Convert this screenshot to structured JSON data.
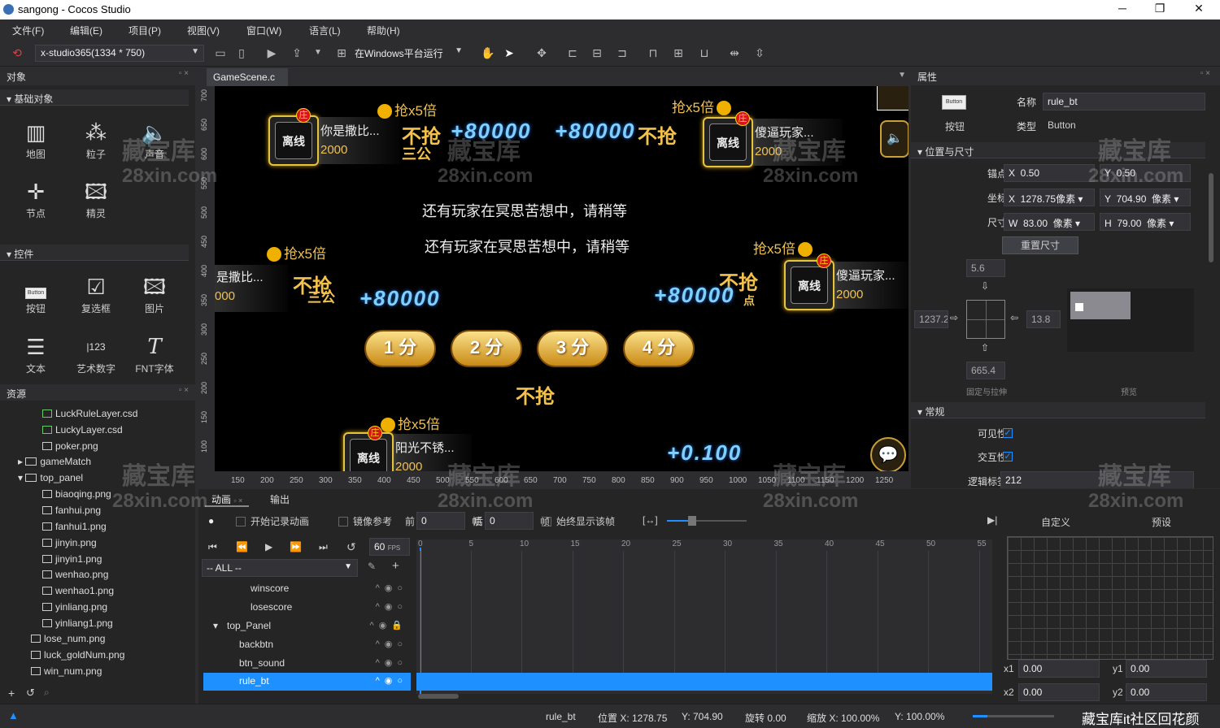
{
  "window": {
    "title": "sangong - Cocos Studio",
    "min": "─",
    "max": "❐",
    "close": "✕"
  },
  "menu": [
    "文件(F)",
    "编辑(E)",
    "项目(P)",
    "视图(V)",
    "窗口(W)",
    "语言(L)",
    "帮助(H)"
  ],
  "toolbar": {
    "resolution": "x-studio365(1334 * 750)",
    "run_target": "在Windows平台运行"
  },
  "objects_panel": {
    "title": "对象",
    "basic_section": "基础对象",
    "basic_items": [
      "地图",
      "粒子",
      "声音",
      "节点",
      "精灵"
    ],
    "controls_section": "控件",
    "control_items": [
      "按钮",
      "复选框",
      "图片",
      "文本",
      "艺术数字",
      "FNT字体"
    ]
  },
  "resources_panel": {
    "title": "资源",
    "items": [
      "LuckRuleLayer.csd",
      "LuckyLayer.csd",
      "poker.png",
      "gameMatch",
      "top_panel",
      "biaoqing.png",
      "fanhui.png",
      "fanhui1.png",
      "jinyin.png",
      "jinyin1.png",
      "wenhao.png",
      "wenhao1.png",
      "yinliang.png",
      "yinliang1.png",
      "lose_num.png",
      "luck_goldNum.png",
      "win_num.png"
    ]
  },
  "scene_tab": "GameScene.c",
  "scene": {
    "rob_label": "抢x5倍",
    "zhuang": "庄",
    "offline": "离线",
    "player1_name": "你是撒比...",
    "player1_score": "2000",
    "player2_name": "傻逼玩家...",
    "player2_score": "2000",
    "player3_name": "是撒比...",
    "player3_score": "000",
    "player4_name": "傻逼玩家...",
    "player4_score": "2000",
    "player5_name": "阳光不锈...",
    "player5_score": "2000",
    "gain1": "+80000",
    "gain2": "+80000",
    "gain3": "+80000",
    "gain4": "+80000",
    "waiting1": "还有玩家在冥思苦想中，请稍等",
    "waiting2": "还有玩家在冥思苦想中，请稍等",
    "no_rob": "不抢",
    "sangong": "三公",
    "score_buttons": [
      "1 分",
      "2 分",
      "3 分",
      "4 分"
    ],
    "bottom_num": "+0.100",
    "point_tag": "点"
  },
  "ruler_h": [
    "150",
    "200",
    "250",
    "300",
    "350",
    "400",
    "450",
    "500",
    "550",
    "600",
    "650",
    "700",
    "750",
    "800",
    "850",
    "900",
    "950",
    "1000",
    "1050",
    "1100",
    "1150",
    "1200",
    "1250"
  ],
  "ruler_v": [
    "700",
    "650",
    "600",
    "550",
    "500",
    "450",
    "400",
    "350",
    "300",
    "250",
    "200",
    "150",
    "100"
  ],
  "properties": {
    "title": "属性",
    "type_icon": "Button",
    "type_caption": "按钮",
    "name_label": "名称",
    "name_value": "rule_bt",
    "kind_label": "类型",
    "kind_value": "Button",
    "pos_section": "位置与尺寸",
    "anchor_label": "锚点",
    "anchor_x": "0.50",
    "anchor_y": "0.50",
    "pos_label": "坐标",
    "pos_x": "1278.75",
    "pos_y": "704.90",
    "unit": "像素",
    "size_label": "尺寸",
    "size_w": "83.00",
    "size_h": "79.00",
    "reset_size": "重置尺寸",
    "margin_top": "5.6",
    "margin_left": "1237.2",
    "margin_right": "13.8",
    "margin_bottom": "665.4",
    "fix_label": "固定与拉伸",
    "preview_label": "预览",
    "general_section": "常规",
    "visible_label": "可见性",
    "interactive_label": "交互性",
    "logic_tag_label": "逻辑标签",
    "logic_tag_value": "212"
  },
  "animation": {
    "tab_anim": "动画",
    "tab_output": "输出",
    "record": "开始记录动画",
    "mirror": "镜像参考",
    "before_label": "前",
    "before_val": "0",
    "after_label": "后",
    "after_val": "0",
    "frame_unit": "帧",
    "show_frame": "始终显示该帧",
    "fps": "60",
    "fps_unit": "FPS",
    "filter": "-- ALL --",
    "custom": "自定义",
    "preset": "预设",
    "timeline_ticks": [
      "0",
      "5",
      "10",
      "15",
      "20",
      "25",
      "30",
      "35",
      "40",
      "45",
      "50",
      "55"
    ],
    "nodes": [
      "winscore",
      "losescore",
      "top_Panel",
      "backbtn",
      "btn_sound",
      "rule_bt"
    ],
    "x1": "x1",
    "x1_val": "0.00",
    "y1": "y1",
    "y1_val": "0.00",
    "x2": "x2",
    "x2_val": "0.00",
    "y2": "y2",
    "y2_val": "0.00"
  },
  "status": {
    "node": "rule_bt",
    "pos": "位置 X: 1278.75",
    "pos_y": "Y: 704.90",
    "rotate": "旋转 0.00",
    "scale": "缩放 X: 100.00%",
    "scale_y": "Y: 100.00%"
  },
  "watermark": {
    "line1": "藏宝库",
    "line2": "28xin.com",
    "footer": "藏宝库it社区回花颜"
  }
}
